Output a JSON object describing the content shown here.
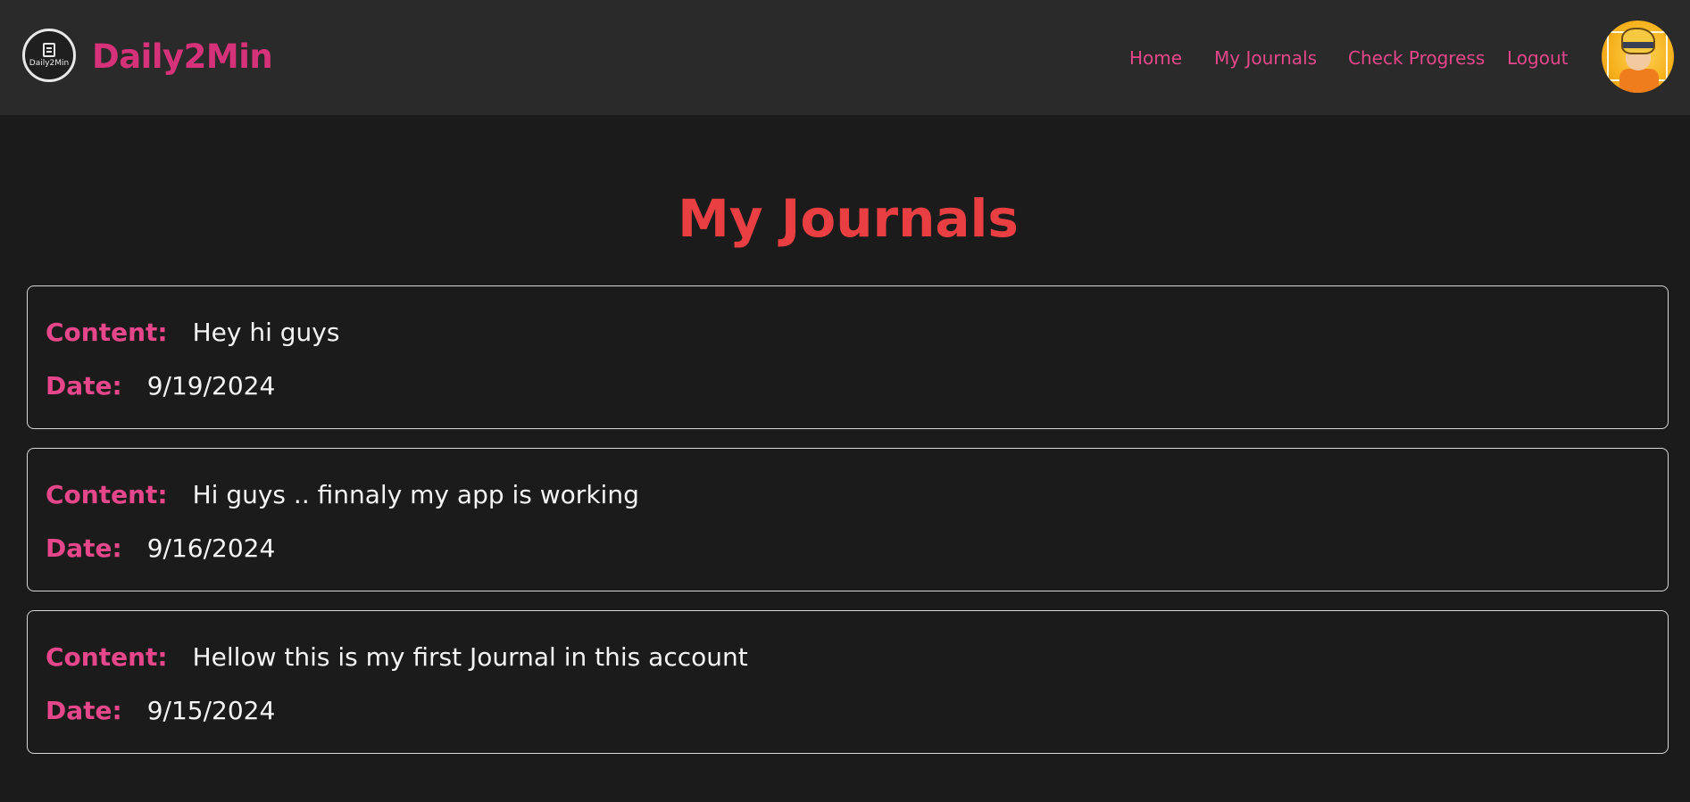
{
  "brand": {
    "logo_text": "Daily2Min",
    "name": "Daily2Min"
  },
  "nav": {
    "items": [
      {
        "label": "Home"
      },
      {
        "label": "My Journals"
      },
      {
        "label": "Check Progress"
      },
      {
        "label": "Logout"
      }
    ],
    "avatar_icon": "user-avatar-icon"
  },
  "page": {
    "title": "My Journals"
  },
  "labels": {
    "content": "Content:",
    "date": "Date:"
  },
  "journals": [
    {
      "content": "Hey hi guys",
      "date": "9/19/2024"
    },
    {
      "content": "Hi guys .. finnaly my app is working",
      "date": "9/16/2024"
    },
    {
      "content": "Hellow this is my first Journal in this account",
      "date": "9/15/2024"
    }
  ],
  "colors": {
    "background": "#1b1b1b",
    "navbar": "#2a2a2a",
    "accent_pink": "#e6478a",
    "brand_pink": "#d6327a",
    "title_red": "#ea3f42",
    "text": "#f4f4f4",
    "card_border": "#d8d8d8"
  }
}
